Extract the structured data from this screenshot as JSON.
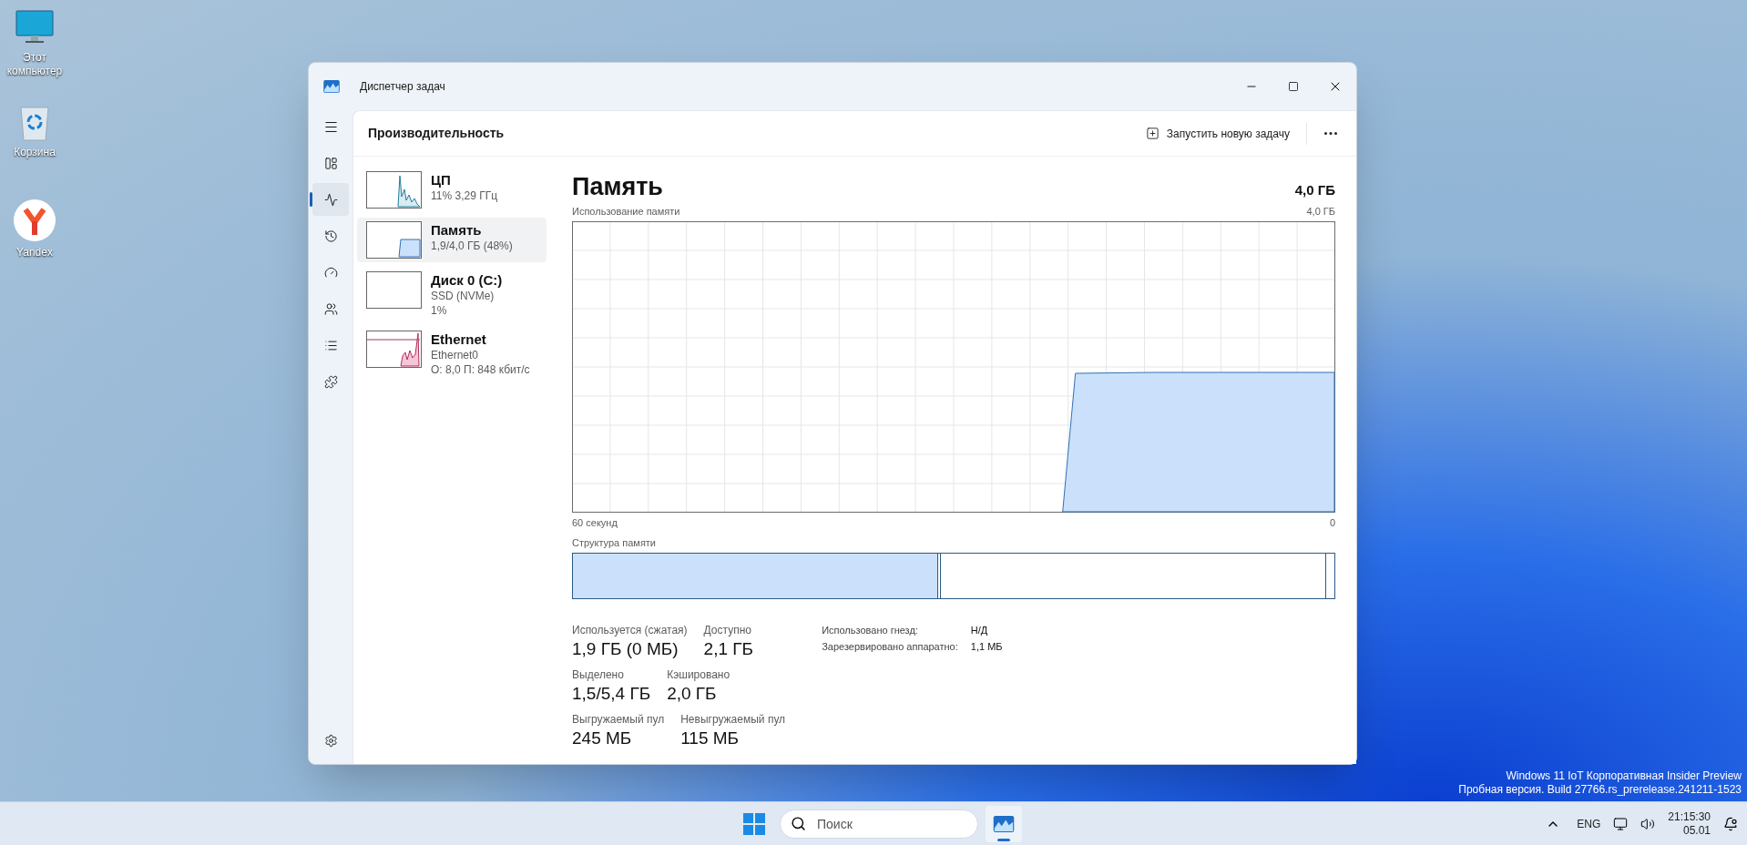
{
  "desktop_icons": [
    {
      "kind": "computer",
      "label": "Этот компьютер"
    },
    {
      "kind": "recycle",
      "label": "Корзина"
    },
    {
      "kind": "yandex",
      "label": "Yandex"
    }
  ],
  "window": {
    "title": "Диспетчер задач"
  },
  "nav_items": [
    {
      "kind": "processes",
      "selected": false
    },
    {
      "kind": "performance",
      "selected": true
    },
    {
      "kind": "history",
      "selected": false
    },
    {
      "kind": "startup",
      "selected": false
    },
    {
      "kind": "users",
      "selected": false
    },
    {
      "kind": "details",
      "selected": false
    },
    {
      "kind": "services",
      "selected": false
    }
  ],
  "header": {
    "title": "Производительность",
    "new_task": "Запустить новую задачу"
  },
  "devices": [
    {
      "kind": "cpu",
      "name": "ЦП",
      "lines": [
        "11% 3,29 ГГц"
      ],
      "selected": false
    },
    {
      "kind": "memory",
      "name": "Память",
      "lines": [
        "1,9/4,0 ГБ (48%)"
      ],
      "selected": true
    },
    {
      "kind": "disk",
      "name": "Диск 0 (C:)",
      "lines": [
        "SSD (NVMe)",
        "1%"
      ],
      "selected": false
    },
    {
      "kind": "network",
      "name": "Ethernet",
      "lines": [
        "Ethernet0",
        "О: 8,0 П: 848 кбит/с"
      ],
      "selected": false
    }
  ],
  "memory": {
    "title": "Память",
    "total": "4,0 ГБ",
    "graph_label": "Использование памяти",
    "graph_max": "4,0 ГБ",
    "x_start": "60 секунд",
    "x_end": "0",
    "structure": {
      "label": "Структура памяти",
      "level": 0.48
    }
  },
  "stats": [
    [
      {
        "label": "Используется (сжатая)",
        "value": "1,9 ГБ (0 МБ)"
      },
      {
        "label": "Доступно",
        "value": "2,1 ГБ"
      }
    ],
    [
      {
        "label": "Выделено",
        "value": "1,5/5,4 ГБ"
      },
      {
        "label": "Кэшировано",
        "value": "2,0 ГБ"
      }
    ],
    [
      {
        "label": "Выгружаемый пул",
        "value": "245 МБ"
      },
      {
        "label": "Невыгружаемый пул",
        "value": "115 МБ"
      }
    ]
  ],
  "details": [
    {
      "label": "Использовано гнезд:",
      "value": "Н/Д"
    },
    {
      "label": "Зарезервировано аппаратно:",
      "value": "1,1 МБ"
    }
  ],
  "build_info": [
    "Windows 11 IoT Корпоративная Insider Preview",
    "Пробная версия. Build 27766.rs_prerelease.241211-1523"
  ],
  "taskbar": {
    "search_placeholder": "Поиск",
    "language": "ENG",
    "time": "21:15:30",
    "date": "05.01"
  }
}
